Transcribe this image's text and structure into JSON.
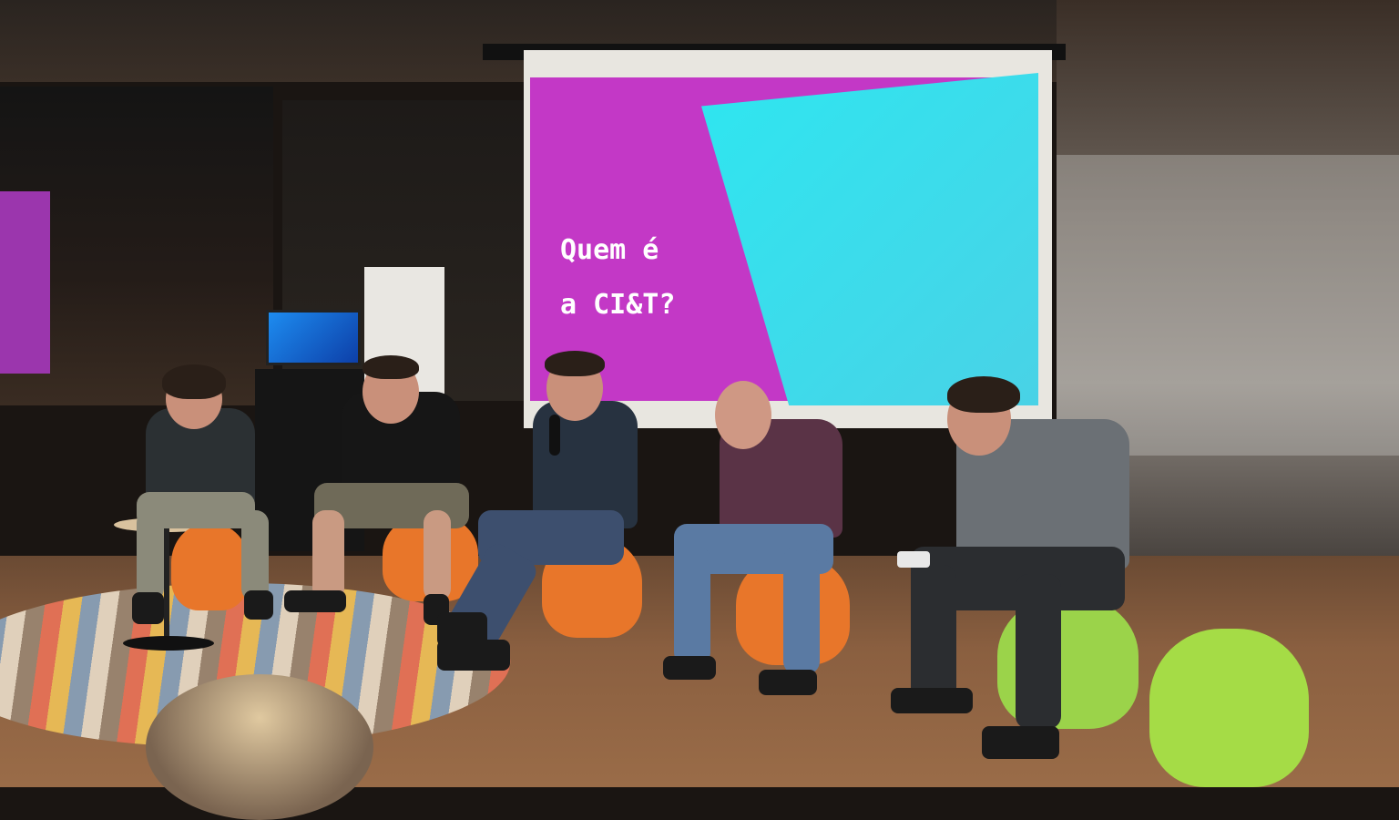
{
  "scene": {
    "description_free": true
  },
  "slide": {
    "title_line1": "Quem é",
    "title_line2": "a CI&T?",
    "background_colors": {
      "magenta": "#c338c6",
      "cyan": "#2ee6f0"
    }
  },
  "colors": {
    "stool_orange": "#e8762a",
    "stool_green": "#9bd34a",
    "floor_wood": "#8a5f40"
  }
}
